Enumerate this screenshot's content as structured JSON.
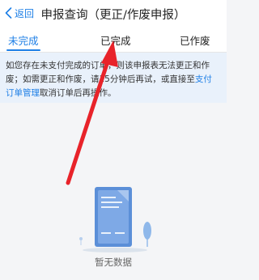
{
  "nav": {
    "back_label": "返回",
    "title": "申报查询（更正/作废申报）"
  },
  "tabs": [
    {
      "label": "未完成",
      "active": true
    },
    {
      "label": "已完成",
      "active": false
    },
    {
      "label": "已作废",
      "active": false
    }
  ],
  "notice": {
    "text_part1": "如您存在未支付完成的订单，则该申报表无法更正和作废；如需更正和作废，请15分钟后再试，或直接至",
    "link_label": "支付订单管理",
    "text_part2": "取消订单后再操作。"
  },
  "empty_state": {
    "text": "暂无数据"
  },
  "colors": {
    "accent": "#1e7fe6",
    "notice_bg": "#e9f1fb",
    "annotation_arrow": "#e8232a"
  }
}
